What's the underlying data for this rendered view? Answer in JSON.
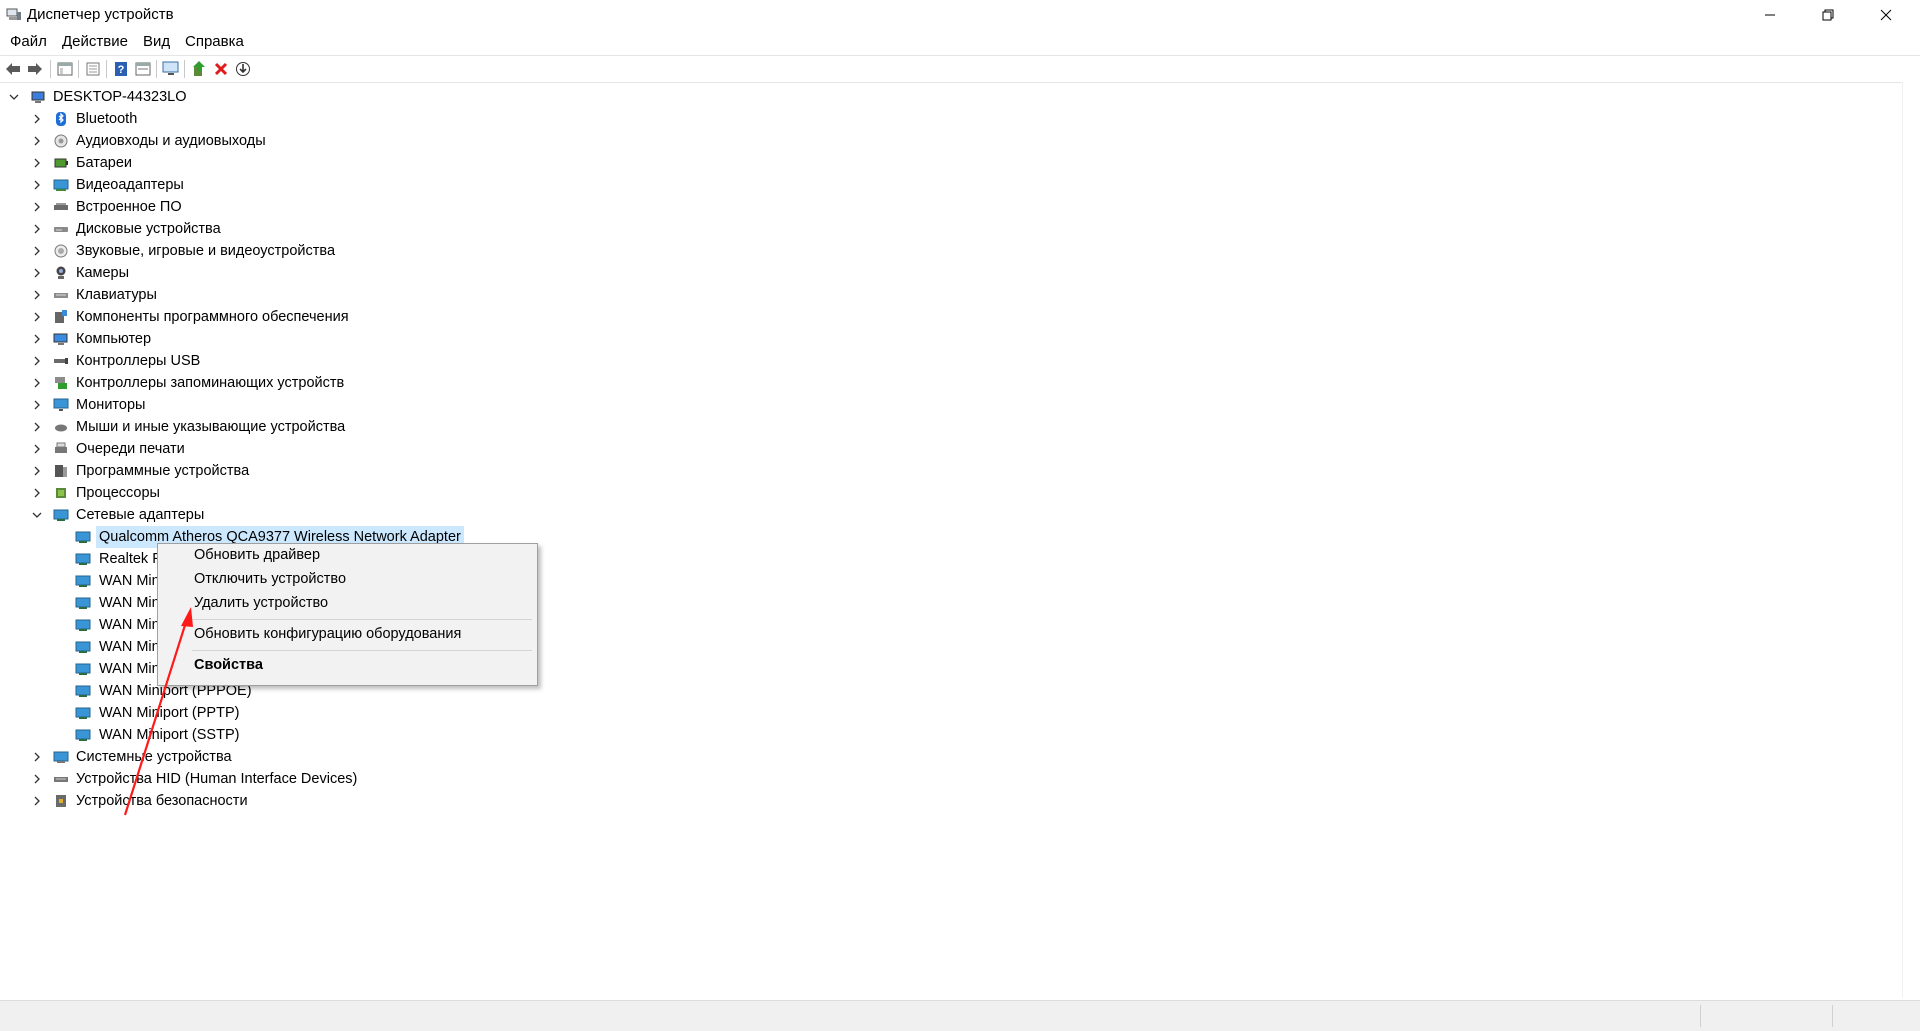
{
  "window": {
    "title": "Диспетчер устройств",
    "controls": [
      "minimize",
      "restore",
      "close"
    ]
  },
  "menu": [
    "Файл",
    "Действие",
    "Вид",
    "Справка"
  ],
  "toolbar": [
    "back-icon",
    "forward-icon",
    "console-tree-icon",
    "properties-icon",
    "help-icon",
    "view-icon",
    "monitor-scan-icon",
    "update-driver-icon",
    "uninstall-icon",
    "download-icon"
  ],
  "tree": {
    "root": "DESKTOP-44323LO",
    "categories": [
      {
        "label": "Bluetooth",
        "icon": "bluetooth-icon"
      },
      {
        "label": "Аудиовходы и аудиовыходы",
        "icon": "speaker-icon"
      },
      {
        "label": "Батареи",
        "icon": "battery-icon"
      },
      {
        "label": "Видеоадаптеры",
        "icon": "display-adapter-icon"
      },
      {
        "label": "Встроенное ПО",
        "icon": "firmware-icon"
      },
      {
        "label": "Дисковые устройства",
        "icon": "disk-icon"
      },
      {
        "label": "Звуковые, игровые и видеоустройства",
        "icon": "sound-icon"
      },
      {
        "label": "Камеры",
        "icon": "camera-icon"
      },
      {
        "label": "Клавиатуры",
        "icon": "keyboard-icon"
      },
      {
        "label": "Компоненты программного обеспечения",
        "icon": "software-component-icon"
      },
      {
        "label": "Компьютер",
        "icon": "computer-icon"
      },
      {
        "label": "Контроллеры USB",
        "icon": "usb-icon"
      },
      {
        "label": "Контроллеры запоминающих устройств",
        "icon": "storage-controller-icon"
      },
      {
        "label": "Мониторы",
        "icon": "monitor-icon"
      },
      {
        "label": "Мыши и иные указывающие устройства",
        "icon": "mouse-icon"
      },
      {
        "label": "Очереди печати",
        "icon": "printer-icon"
      },
      {
        "label": "Программные устройства",
        "icon": "software-device-icon"
      },
      {
        "label": "Процессоры",
        "icon": "processor-icon"
      },
      {
        "label": "Сетевые адаптеры",
        "icon": "network-adapter-icon"
      }
    ],
    "network_adapters": [
      "Qualcomm Atheros QCA9377 Wireless Network Adapter",
      "Realtek P",
      "WAN Mini",
      "WAN Mini",
      "WAN Mini",
      "WAN Mini",
      "WAN Mini",
      "WAN Miniport (PPPOE)",
      "WAN Miniport (PPTP)",
      "WAN Miniport (SSTP)"
    ],
    "after": [
      {
        "label": "Системные устройства",
        "icon": "system-device-icon"
      },
      {
        "label": "Устройства HID (Human Interface Devices)",
        "icon": "hid-icon"
      },
      {
        "label": "Устройства безопасности",
        "icon": "security-device-icon"
      }
    ]
  },
  "context_menu": {
    "items": [
      "Обновить драйвер",
      "Отключить устройство",
      "Удалить устройство",
      "Обновить конфигурацию оборудования",
      "Свойства"
    ]
  },
  "colors": {
    "selection": "#cce8ff",
    "arrow": "#ff0000",
    "menu_bg": "#f2f2f2"
  }
}
